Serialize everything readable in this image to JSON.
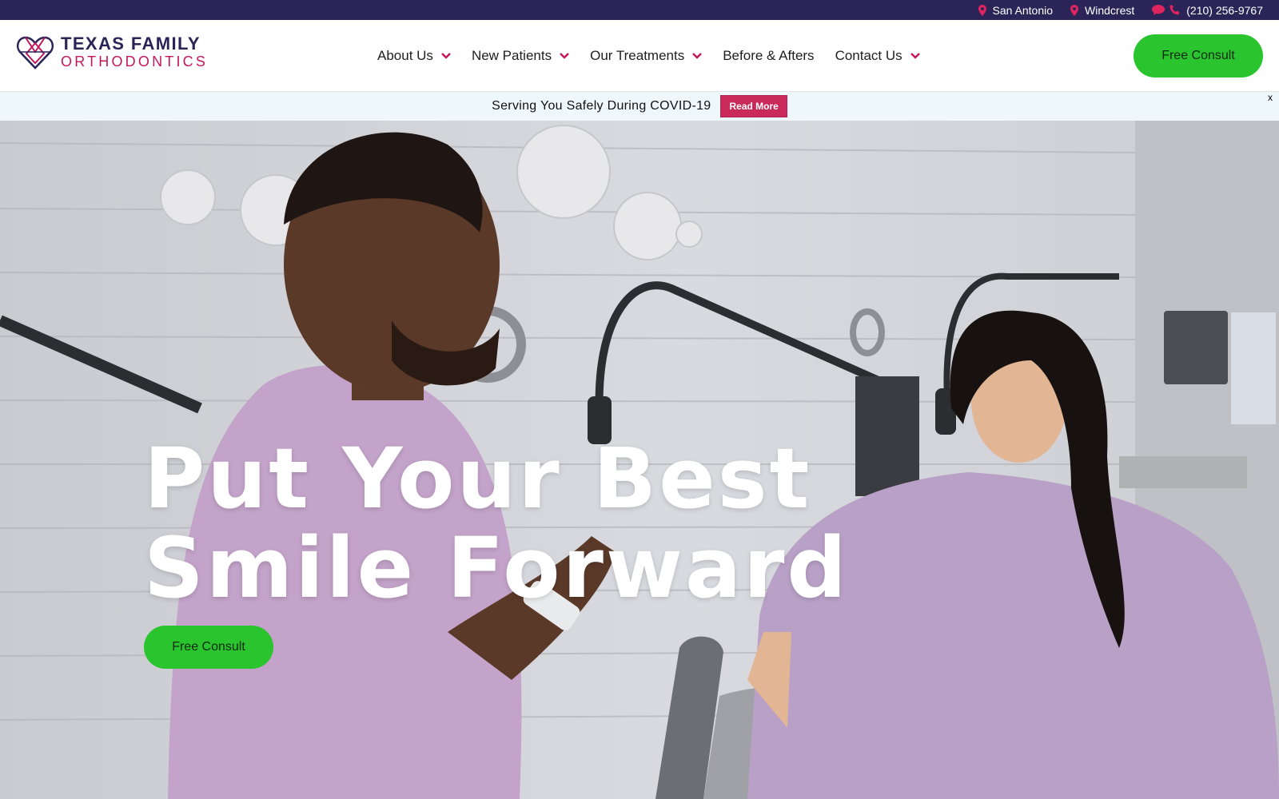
{
  "topbar": {
    "locations": [
      {
        "label": "San Antonio",
        "icon": "map-pin-icon"
      },
      {
        "label": "Windcrest",
        "icon": "map-pin-icon"
      }
    ],
    "phone": "(210) 256-9767",
    "icons": [
      "chat-icon",
      "phone-icon"
    ]
  },
  "header": {
    "logo": {
      "line1": "TEXAS FAMILY",
      "line2": "ORTHODONTICS"
    },
    "nav": [
      {
        "label": "About Us",
        "has_dropdown": true
      },
      {
        "label": "New Patients",
        "has_dropdown": true
      },
      {
        "label": "Our Treatments",
        "has_dropdown": true
      },
      {
        "label": "Before & Afters",
        "has_dropdown": false
      },
      {
        "label": "Contact Us",
        "has_dropdown": true
      }
    ],
    "cta_label": "Free Consult"
  },
  "banner": {
    "text": "Serving You Safely During COVID-19",
    "button_label": "Read More",
    "close_label": "x"
  },
  "hero": {
    "title_line1": "Put Your Best",
    "title_line2": "Smile Forward",
    "cta_label": "Free Consult"
  },
  "colors": {
    "topbar_bg": "#2b2457",
    "brand_navy": "#2b2457",
    "brand_magenta": "#c2185b",
    "cta_green": "#29c42e",
    "banner_button": "#c92a5a",
    "banner_bg": "#eef8fb"
  }
}
